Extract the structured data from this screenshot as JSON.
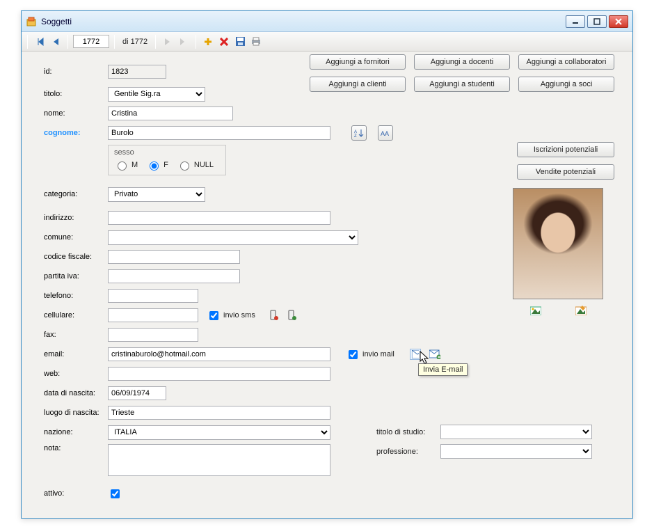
{
  "window": {
    "title": "Soggetti"
  },
  "nav": {
    "pos": "1772",
    "of_label": "di 1772"
  },
  "actions": {
    "add_fornitori": "Aggiungi a fornitori",
    "add_docenti": "Aggiungi a docenti",
    "add_collaboratori": "Aggiungi a collaboratori",
    "add_clienti": "Aggiungi a clienti",
    "add_studenti": "Aggiungi a studenti",
    "add_soci": "Aggiungi a soci",
    "iscr_pot": "Iscrizioni potenziali",
    "vend_pot": "Vendite potenziali"
  },
  "labels": {
    "id": "id:",
    "titolo": "titolo:",
    "nome": "nome:",
    "cognome": "cognome:",
    "sesso": "sesso",
    "M": "M",
    "F": "F",
    "NULL": "NULL",
    "categoria": "categoria:",
    "indirizzo": "indirizzo:",
    "comune": "comune:",
    "codice_fiscale": "codice fiscale:",
    "partita_iva": "partita iva:",
    "telefono": "telefono:",
    "cellulare": "cellulare:",
    "fax": "fax:",
    "email": "email:",
    "web": "web:",
    "data_nascita": "data di nascita:",
    "luogo_nascita": "luogo di nascita:",
    "nazione": "nazione:",
    "nota": "nota:",
    "attivo": "attivo:",
    "invio_sms": "invio sms",
    "invio_mail": "invio mail",
    "titolo_studio": "titolo di studio:",
    "professione": "professione:"
  },
  "values": {
    "id": "1823",
    "titolo": "Gentile Sig.ra",
    "nome": "Cristina",
    "cognome": "Burolo",
    "sesso": "F",
    "categoria": "Privato",
    "indirizzo": "",
    "comune": "",
    "codice_fiscale": "",
    "partita_iva": "",
    "telefono": "",
    "cellulare": "",
    "fax": "",
    "email": "cristinaburolo@hotmail.com",
    "web": "",
    "data_nascita": "06/09/1974",
    "luogo_nascita": "Trieste",
    "nazione": "ITALIA",
    "nota": "",
    "attivo": true,
    "invio_sms": true,
    "invio_mail": true,
    "titolo_studio": "",
    "professione": ""
  },
  "tooltip": {
    "send_mail": "Invia E-mail"
  }
}
